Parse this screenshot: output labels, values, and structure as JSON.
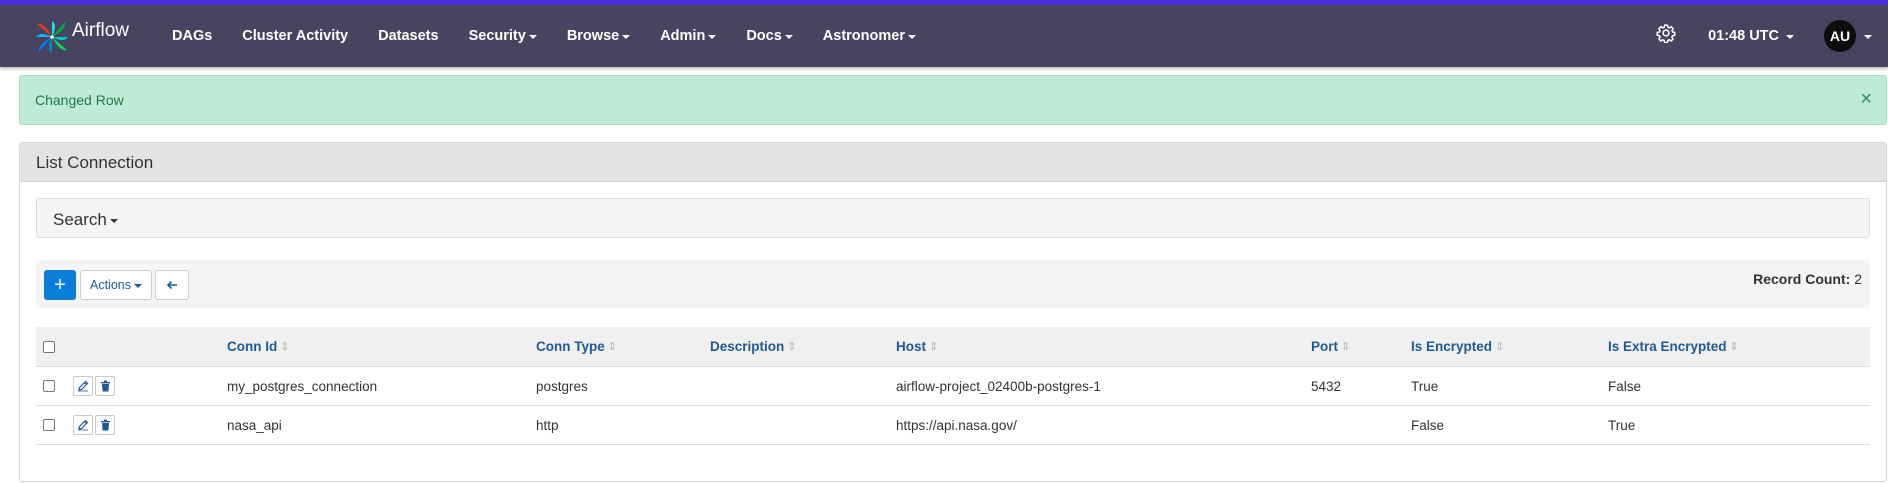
{
  "navbar": {
    "brand": "Airflow",
    "items": [
      {
        "label": "DAGs",
        "dropdown": false
      },
      {
        "label": "Cluster Activity",
        "dropdown": false
      },
      {
        "label": "Datasets",
        "dropdown": false
      },
      {
        "label": "Security",
        "dropdown": true
      },
      {
        "label": "Browse",
        "dropdown": true
      },
      {
        "label": "Admin",
        "dropdown": true
      },
      {
        "label": "Docs",
        "dropdown": true
      },
      {
        "label": "Astronomer",
        "dropdown": true
      }
    ],
    "time": "01:48 UTC",
    "user_initials": "AU",
    "settings_icon": "gear-icon"
  },
  "alert": {
    "message": "Changed Row",
    "close": "×"
  },
  "panel": {
    "title": "List Connection",
    "search_label": "Search",
    "toolbar": {
      "add_label": "+",
      "actions_label": "Actions",
      "back_icon": "arrow-left-icon",
      "record_count_label": "Record Count:",
      "record_count": "2"
    },
    "table": {
      "columns": [
        "Conn Id",
        "Conn Type",
        "Description",
        "Host",
        "Port",
        "Is Encrypted",
        "Is Extra Encrypted"
      ],
      "rows": [
        {
          "conn_id": "my_postgres_connection",
          "conn_type": "postgres",
          "description": "",
          "host": "airflow-project_02400b-postgres-1",
          "port": "5432",
          "is_encrypted": "True",
          "is_extra_encrypted": "False"
        },
        {
          "conn_id": "nasa_api",
          "conn_type": "http",
          "description": "",
          "host": "https://api.nasa.gov/",
          "port": "",
          "is_encrypted": "False",
          "is_extra_encrypted": "True"
        }
      ]
    }
  },
  "colors": {
    "navbar_bg": "#47445f",
    "navbar_accent": "#4b2fd6",
    "alert_bg": "#beebd5",
    "alert_text": "#1f7a48",
    "primary_button": "#0b7dda",
    "link_color": "#1f5a96"
  }
}
